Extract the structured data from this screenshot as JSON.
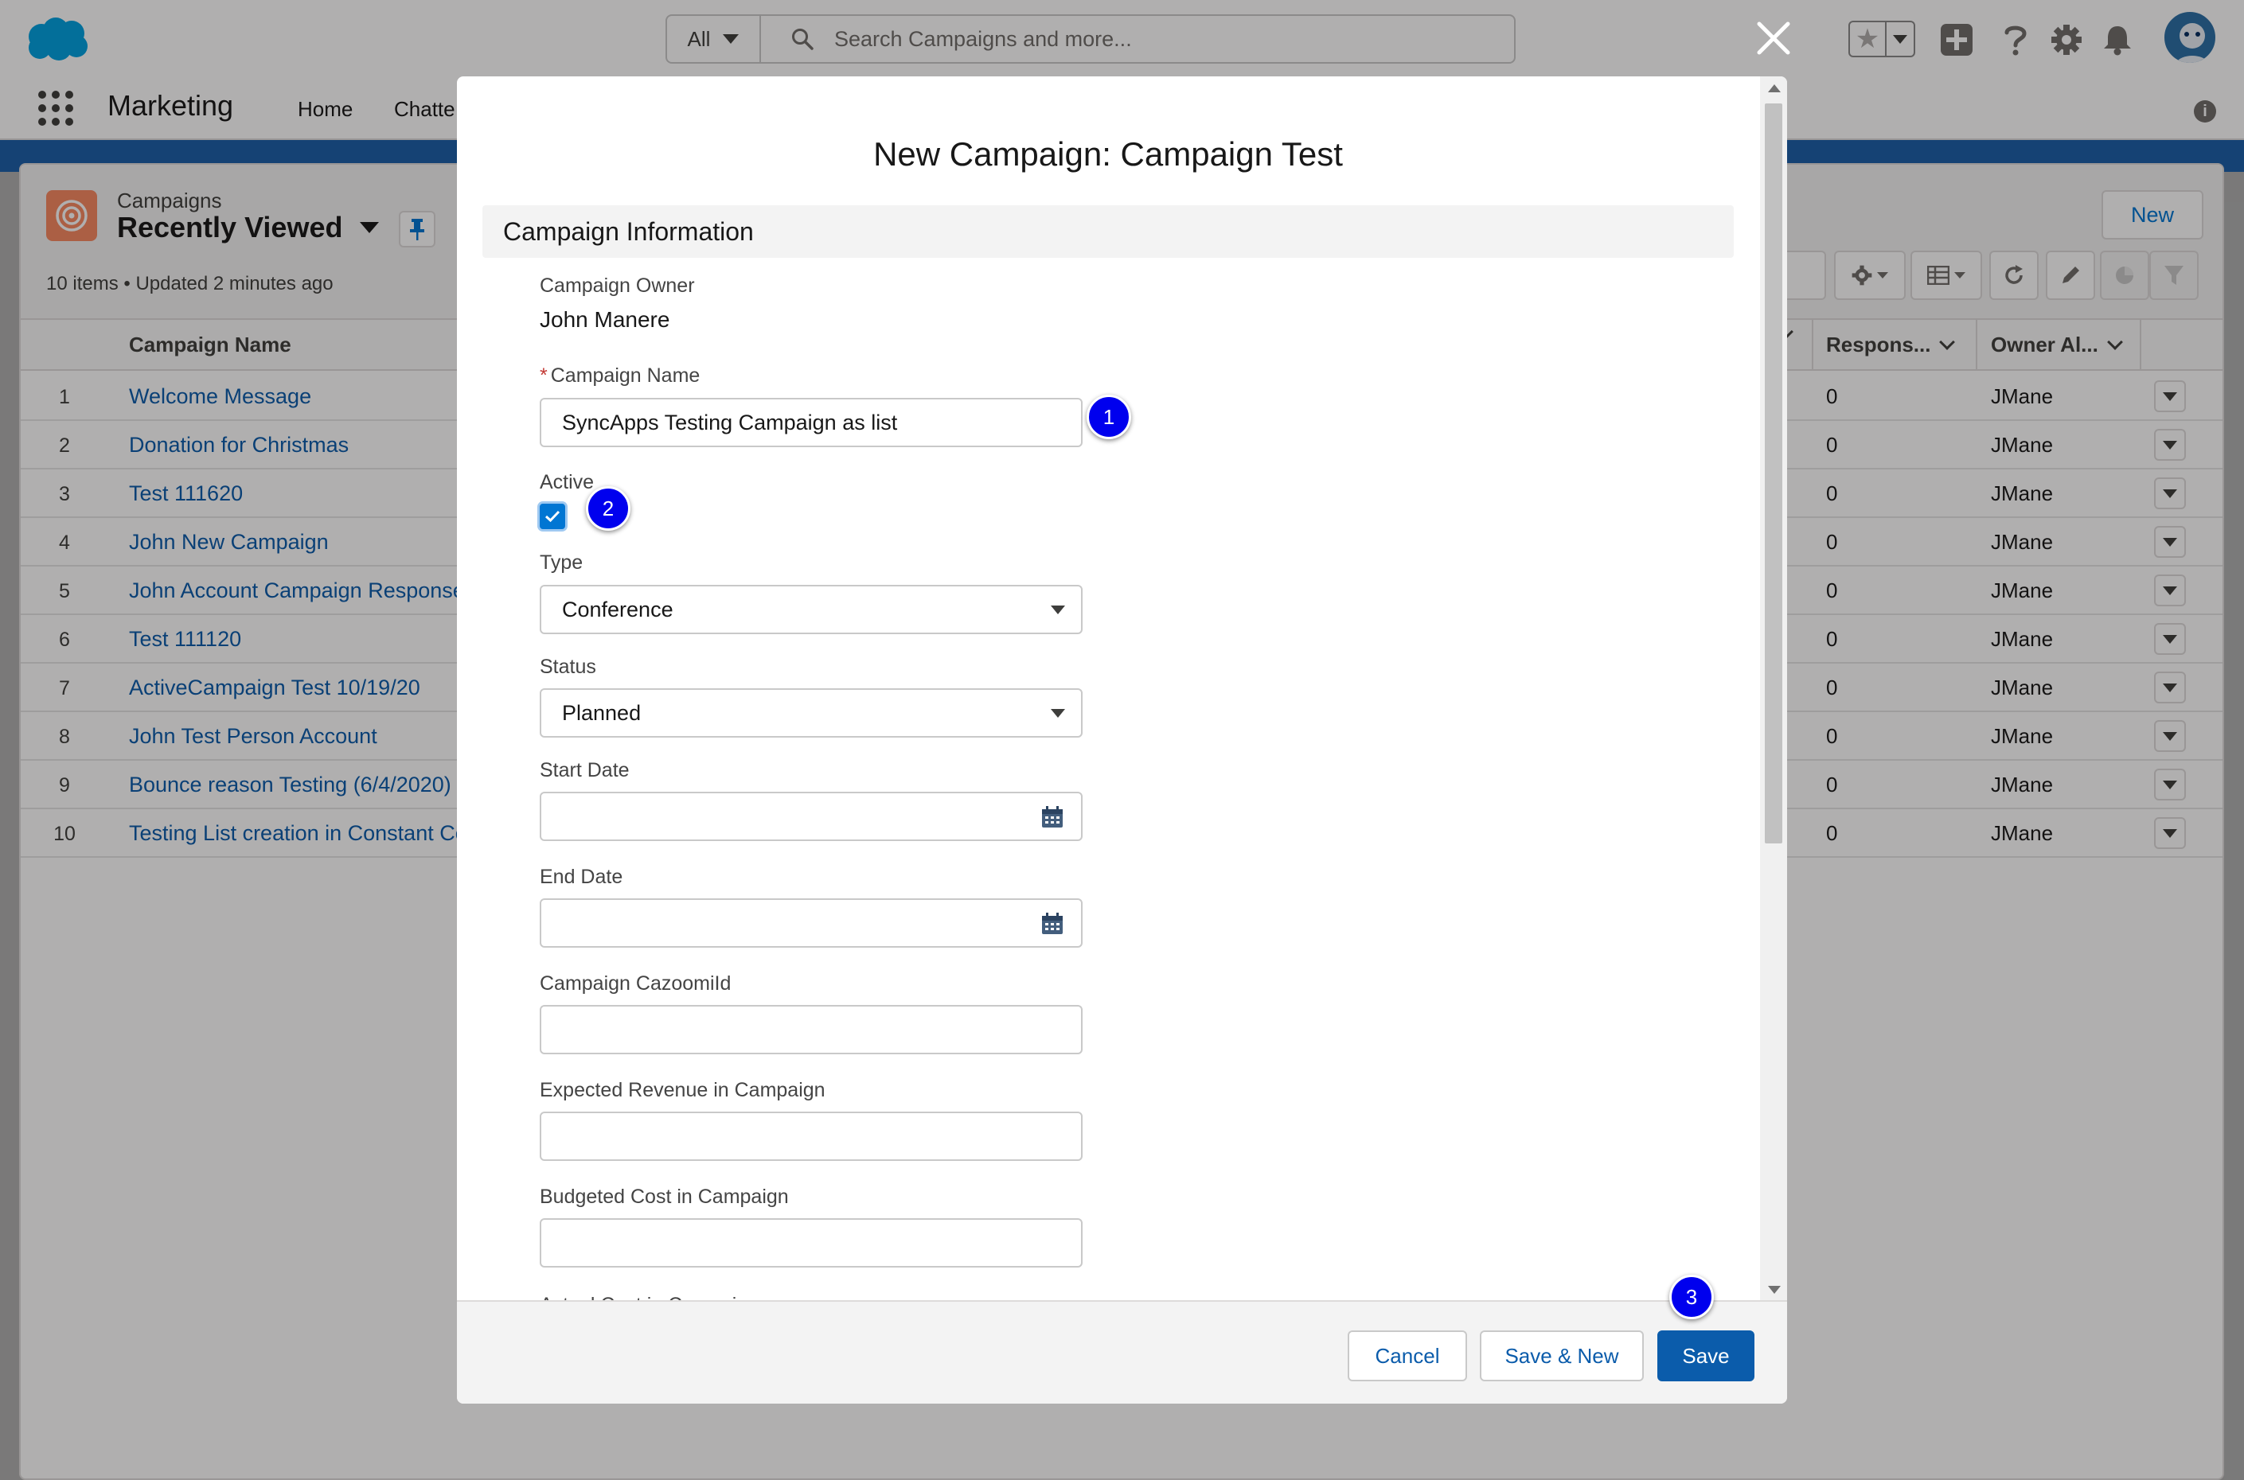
{
  "header": {
    "search_scope": "All",
    "search_placeholder": "Search Campaigns and more...",
    "icons": [
      "salesforce-cloud-icon",
      "search-icon",
      "star-icon",
      "add-icon",
      "help-icon",
      "setup-gear-icon",
      "bell-icon",
      "avatar"
    ]
  },
  "nav": {
    "app_name": "Marketing",
    "items": [
      "Home",
      "Chatte"
    ]
  },
  "list": {
    "object_label": "Campaigns",
    "view_name": "Recently Viewed",
    "meta": "10 items • Updated 2 minutes ago",
    "new_button": "New",
    "columns": {
      "name": "Campaign Name",
      "responses": "Respons...",
      "owner": "Owner Al..."
    },
    "rows": [
      {
        "num": "1",
        "name": "Welcome Message",
        "responses": "0",
        "owner": "JMane"
      },
      {
        "num": "2",
        "name": "Donation for Christmas",
        "responses": "0",
        "owner": "JMane"
      },
      {
        "num": "3",
        "name": "Test 111620",
        "responses": "0",
        "owner": "JMane"
      },
      {
        "num": "4",
        "name": "John New Campaign",
        "responses": "0",
        "owner": "JMane"
      },
      {
        "num": "5",
        "name": "John Account Campaign Response",
        "responses": "0",
        "owner": "JMane"
      },
      {
        "num": "6",
        "name": "Test 111120",
        "responses": "0",
        "owner": "JMane"
      },
      {
        "num": "7",
        "name": "ActiveCampaign Test 10/19/20",
        "responses": "0",
        "owner": "JMane"
      },
      {
        "num": "8",
        "name": "John Test Person Account",
        "responses": "0",
        "owner": "JMane"
      },
      {
        "num": "9",
        "name": "Bounce reason Testing (6/4/2020)",
        "responses": "0",
        "owner": "JMane"
      },
      {
        "num": "10",
        "name": "Testing List creation in Constant Co",
        "responses": "0",
        "owner": "JMane"
      }
    ]
  },
  "modal": {
    "title": "New Campaign: Campaign Test",
    "section": "Campaign Information",
    "owner_label": "Campaign Owner",
    "owner_value": "John Manere",
    "name_label": "Campaign Name",
    "name_value": "SyncApps Testing Campaign as list",
    "active_label": "Active",
    "active_checked": true,
    "type_label": "Type",
    "type_value": "Conference",
    "status_label": "Status",
    "status_value": "Planned",
    "start_label": "Start Date",
    "start_value": "",
    "end_label": "End Date",
    "end_value": "",
    "cazoomi_label": "Campaign CazoomiId",
    "cazoomi_value": "",
    "revenue_label": "Expected Revenue in Campaign",
    "revenue_value": "",
    "budget_label": "Budgeted Cost in Campaign",
    "budget_value": "",
    "actual_label_partial": "Actual Cost in Campaign",
    "cancel": "Cancel",
    "save_new": "Save & New",
    "save": "Save"
  },
  "annotations": {
    "step1": "1",
    "step2": "2",
    "step3": "3"
  },
  "colors": {
    "brand": "#0b5cab",
    "accent": "#0176d3",
    "badge": "#0000ee",
    "header_band": "#1b5fa8",
    "campaign_icon": "#f88962"
  }
}
